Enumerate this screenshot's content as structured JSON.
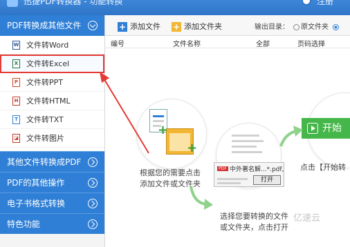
{
  "window": {
    "title": "迅捷PDF转换器 - 功能转换",
    "user": "注册"
  },
  "sidebar": {
    "top_category": "PDF转换成其他文件",
    "items": [
      {
        "label": "文件转Word",
        "icon": "word-file-icon",
        "badge": "W",
        "color": "#2b5797"
      },
      {
        "label": "文件转Excel",
        "icon": "excel-file-icon",
        "badge": "X",
        "color": "#1e7145",
        "active": true
      },
      {
        "label": "文件转PPT",
        "icon": "ppt-file-icon",
        "badge": "P",
        "color": "#d24726"
      },
      {
        "label": "文件转HTML",
        "icon": "html-file-icon",
        "badge": "H",
        "color": "#c0392b"
      },
      {
        "label": "文件转TXT",
        "icon": "txt-file-icon",
        "badge": "T",
        "color": "#2f7fd6"
      },
      {
        "label": "文件转图片",
        "icon": "image-file-icon",
        "badge": "◪",
        "color": "#c0392b"
      }
    ],
    "categories": [
      "其他文件转换成PDF",
      "PDF的其他操作",
      "电子书格式转换",
      "特色功能"
    ]
  },
  "toolbar": {
    "add_file": "添加文件",
    "add_folder": "添加文件夹",
    "output_label": "输出目录：",
    "option_source": "原文件夹"
  },
  "table": {
    "headers": [
      "编号",
      "文件名称",
      "全部",
      "页码选择"
    ]
  },
  "illustration": {
    "step1_line1": "根据您的需要点击",
    "step1_line2": "添加文件或文件夹",
    "step2_line1": "选择您要转换的文件",
    "step2_line2": "或文件夹，点击打开",
    "step3_line1": "点击【开始转",
    "start_button": "开始",
    "dialog_file": "中外著名解...*.pdf,",
    "dialog_open": "打开",
    "watermark": "亿速云"
  },
  "colors": {
    "accent": "#2f7fd6",
    "highlight": "#e53935",
    "start_green": "#45b74a"
  }
}
